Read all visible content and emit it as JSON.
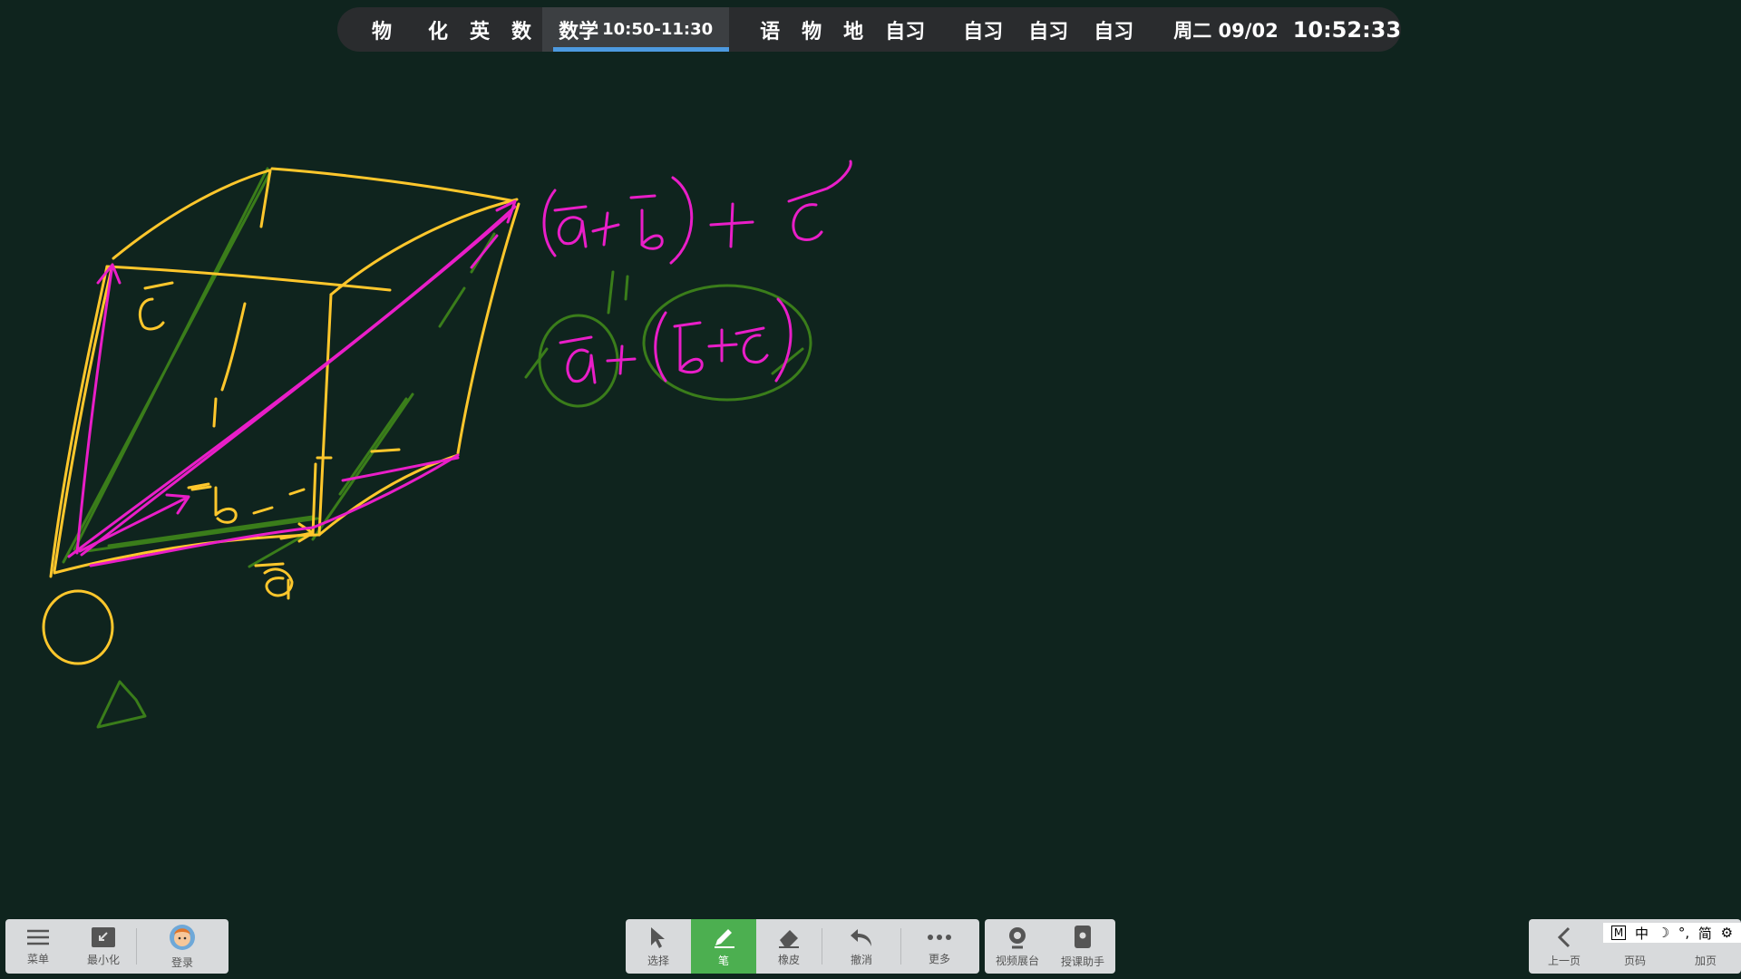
{
  "schedule": {
    "group1": [
      "物"
    ],
    "group2": [
      "化",
      "英",
      "数"
    ],
    "current": {
      "subject": "数学",
      "time": "10:50-11:30"
    },
    "group3": [
      "语",
      "物",
      "地",
      "自习"
    ],
    "group4": [
      "自习",
      "自习",
      "自习"
    ],
    "date": "周二 09/02",
    "clock": "10:52:33"
  },
  "colors": {
    "background": "#0f241e",
    "yellow": "#ffc72c",
    "magenta": "#e91ec8",
    "green": "#3a7d1a",
    "accent_active": "#4caf50",
    "current_underline": "#4d9ae0"
  },
  "toolbar_left": [
    {
      "label": "菜单",
      "icon": "menu-icon"
    },
    {
      "label": "最小化",
      "icon": "minimize-icon"
    },
    {
      "label": "登录",
      "icon": "avatar-icon"
    }
  ],
  "toolbar_center": [
    {
      "label": "选择",
      "icon": "cursor-icon",
      "active": false
    },
    {
      "label": "笔",
      "icon": "pen-icon",
      "active": true
    },
    {
      "label": "橡皮",
      "icon": "eraser-icon",
      "active": false
    },
    {
      "label": "撤消",
      "icon": "undo-icon",
      "active": false
    },
    {
      "label": "更多",
      "icon": "more-icon",
      "active": false
    }
  ],
  "toolbar_media": [
    {
      "label": "视频展台",
      "icon": "camera-icon"
    },
    {
      "label": "授课助手",
      "icon": "tablet-icon"
    }
  ],
  "toolbar_right": [
    {
      "label": "上一页",
      "icon": "chevron-left-icon"
    },
    {
      "label": "页码",
      "icon": "page-number-icon"
    },
    {
      "label": "加页",
      "icon": "add-page-icon"
    }
  ],
  "ime": {
    "mode": "M",
    "lang": "中",
    "moon": "☽",
    "punct": "°,",
    "simplified": "简",
    "settings": "⚙"
  }
}
